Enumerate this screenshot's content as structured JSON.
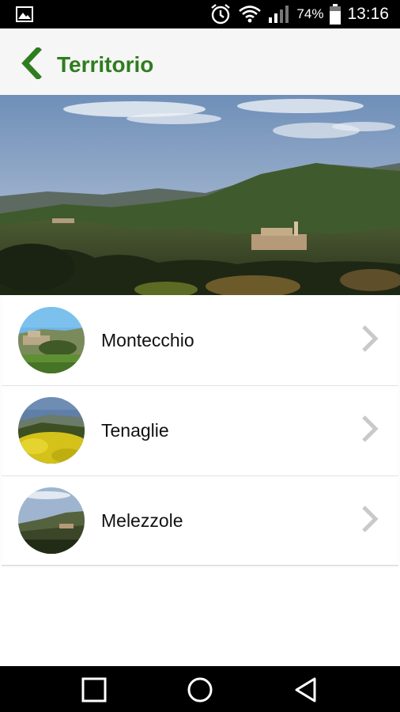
{
  "status_bar": {
    "battery_percent": "74%",
    "time": "13:16",
    "icons": [
      "gallery-icon",
      "alarm-icon",
      "wifi-icon",
      "signal-icon",
      "battery-icon"
    ]
  },
  "app_bar": {
    "title": "Territorio",
    "back_icon": "chevron-left-icon",
    "accent_color": "#2e7d1f"
  },
  "list": {
    "items": [
      {
        "label": "Montecchio",
        "thumb": "thumbnail-montecchio",
        "chevron": "chevron-right-icon"
      },
      {
        "label": "Tenaglie",
        "thumb": "thumbnail-tenaglie",
        "chevron": "chevron-right-icon"
      },
      {
        "label": "Melezzole",
        "thumb": "thumbnail-melezzole",
        "chevron": "chevron-right-icon"
      }
    ]
  },
  "nav_bar": {
    "buttons": [
      "recents-square-icon",
      "home-circle-icon",
      "back-triangle-icon"
    ]
  }
}
